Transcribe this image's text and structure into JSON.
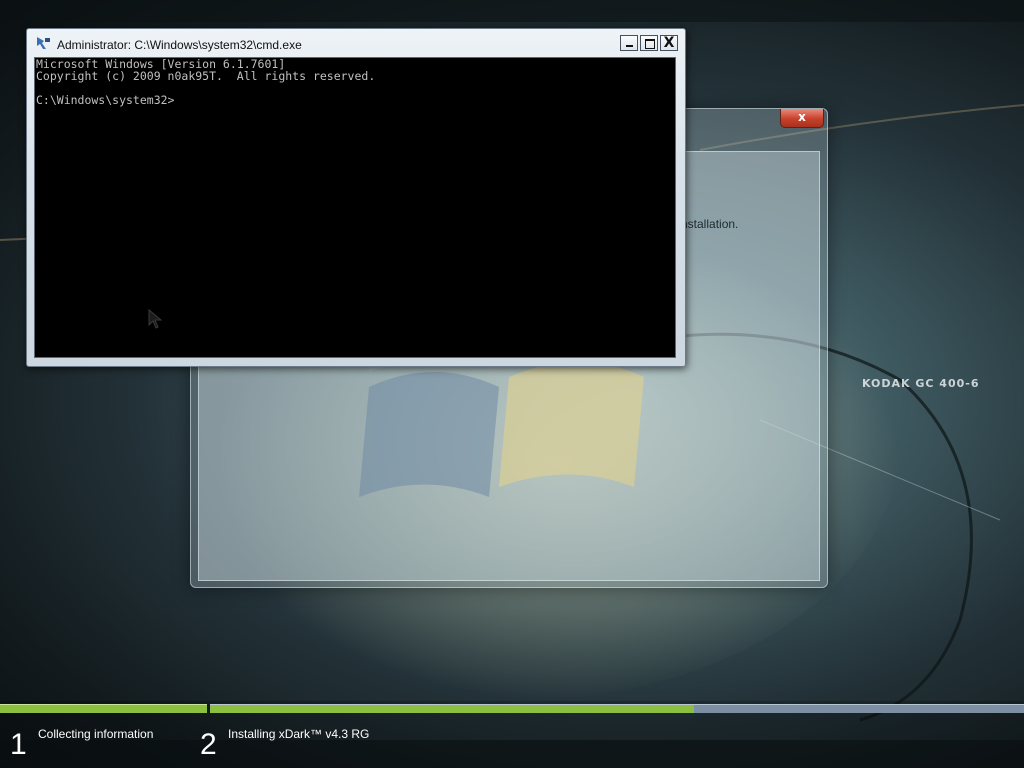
{
  "setup_window": {
    "close_label": "x",
    "partial_text": "nstallation."
  },
  "cmd_window": {
    "title": "Administrator: C:\\Windows\\system32\\cmd.exe",
    "minimize_icon": "minimize-icon",
    "maximize_icon": "maximize-icon",
    "close_label": "X",
    "console_lines": [
      "Microsoft Windows [Version 6.1.7601]",
      "Copyright (c) 2009 n0ak95T.  All rights reserved.",
      "",
      "C:\\Windows\\system32>"
    ]
  },
  "steps": [
    {
      "number": "1",
      "label": "Collecting information"
    },
    {
      "number": "2",
      "label": "Installing xDark™ v4.3 RG"
    }
  ],
  "progress": {
    "step1_fraction": 1.0,
    "step2_fraction": 0.595
  },
  "colors": {
    "progress_fill": "#8cbf3f",
    "progress_track": "#7d8fa3",
    "console_bg": "#000000",
    "console_text": "#c0c0c0"
  },
  "background_text": "KODAK GC 400-6"
}
